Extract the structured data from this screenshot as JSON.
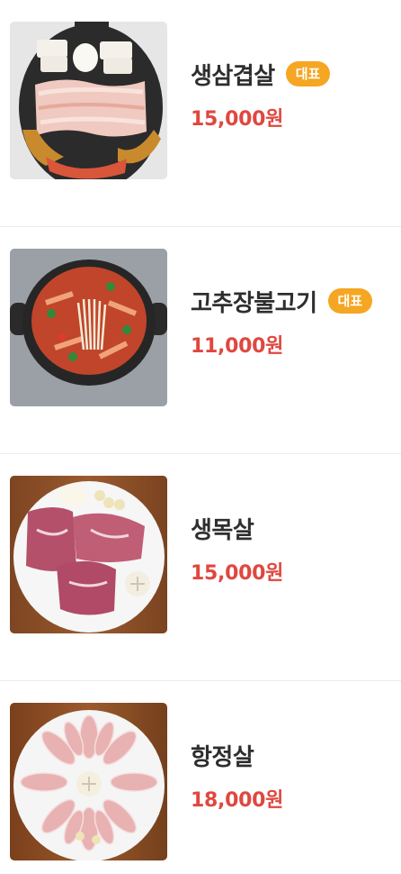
{
  "menu": {
    "items": [
      {
        "name": "생삼겹살",
        "badge": "대표",
        "price": "15,000원",
        "image": "samgyeopsal-photo"
      },
      {
        "name": "고추장불고기",
        "badge": "대표",
        "price": "11,000원",
        "image": "gochujang-bulgogi-photo"
      },
      {
        "name": "생목살",
        "badge": "",
        "price": "15,000원",
        "image": "mokssal-photo"
      },
      {
        "name": "항정살",
        "badge": "",
        "price": "18,000원",
        "image": "hangjeongsal-photo"
      }
    ]
  },
  "colors": {
    "badge": "#f5a623",
    "price": "#e0473f",
    "name": "#2e2e2e"
  }
}
